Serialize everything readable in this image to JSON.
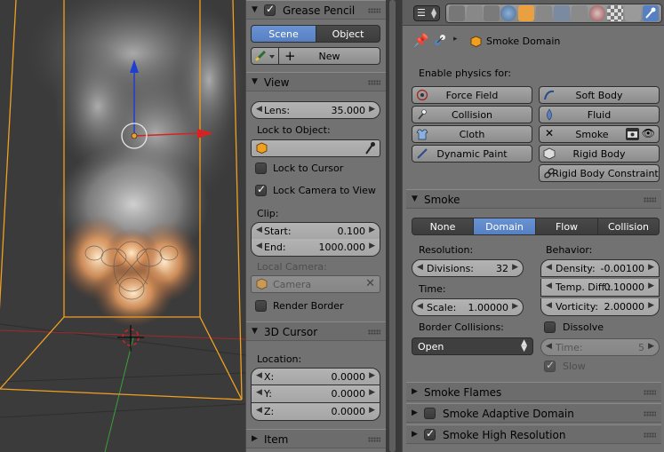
{
  "npanel": {
    "grease_pencil": {
      "title": "Grease Pencil",
      "scene_tab": "Scene",
      "object_tab": "Object",
      "new_label": "New"
    },
    "view": {
      "title": "View",
      "lens_label": "Lens:",
      "lens_value": "35.000",
      "lock_to_object": "Lock to Object:",
      "lock_to_cursor": "Lock to Cursor",
      "lock_camera_to_view": "Lock Camera to View",
      "clip": "Clip:",
      "start_label": "Start:",
      "start_value": "0.100",
      "end_label": "End:",
      "end_value": "1000.000",
      "local_camera": "Local Camera:",
      "camera": "Camera",
      "render_border": "Render Border"
    },
    "cursor": {
      "title": "3D Cursor",
      "location": "Location:",
      "x_label": "X:",
      "x_value": "0.0000",
      "y_label": "Y:",
      "y_value": "0.0000",
      "z_label": "Z:",
      "z_value": "0.0000"
    },
    "item": {
      "title": "Item"
    }
  },
  "props": {
    "breadcrumb": "Smoke Domain",
    "enable_physics": "Enable physics for:",
    "physics_buttons": {
      "force_field": "Force Field",
      "soft_body": "Soft Body",
      "collision": "Collision",
      "fluid": "Fluid",
      "cloth": "Cloth",
      "smoke": "Smoke",
      "dynamic_paint": "Dynamic Paint",
      "rigid_body": "Rigid Body",
      "rigid_body_constraint": "Rigid Body Constraint"
    },
    "smoke": {
      "title": "Smoke",
      "tabs": [
        "None",
        "Domain",
        "Flow",
        "Collision"
      ],
      "resolution": "Resolution:",
      "divisions_label": "Divisions:",
      "divisions_value": "32",
      "time": "Time:",
      "scale_label": "Scale:",
      "scale_value": "1.00000",
      "border_collisions": "Border Collisions:",
      "border_value": "Open",
      "behavior": "Behavior:",
      "density_label": "Density:",
      "density_value": "-0.00100",
      "temp_label": "Temp. Diff.:",
      "temp_value": "0.10000",
      "vorticity_label": "Vorticity:",
      "vorticity_value": "2.00000",
      "dissolve": "Dissolve",
      "dtime_label": "Time:",
      "dtime_value": "5",
      "slow": "Slow"
    },
    "smoke_flames": "Smoke Flames",
    "smoke_adaptive": "Smoke Adaptive Domain",
    "smoke_high_res": "Smoke High Resolution"
  },
  "colors": {
    "accent": "#5680c2",
    "panel_bg": "#727272",
    "axis_x": "#d82222",
    "axis_y": "#1f3fd0",
    "domain_box": "#f0a020"
  }
}
